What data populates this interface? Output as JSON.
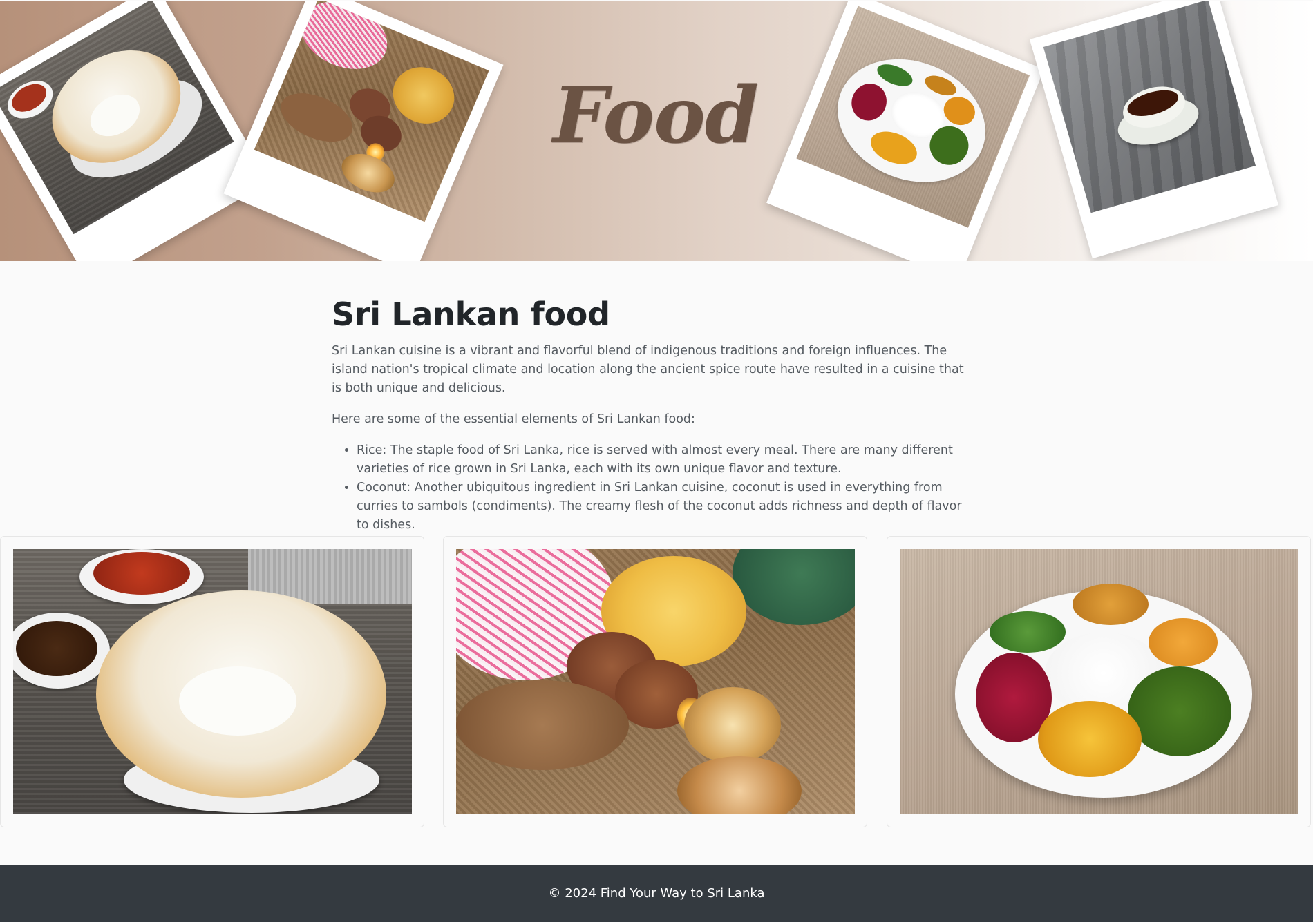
{
  "hero": {
    "title": "Food",
    "images": [
      {
        "icon": "hopper-dish-photo"
      },
      {
        "icon": "sri-lankan-sweets-photo"
      },
      {
        "icon": "rice-and-curry-photo"
      },
      {
        "icon": "tea-cup-photo"
      }
    ]
  },
  "article": {
    "heading": "Sri Lankan food",
    "intro": "Sri Lankan cuisine is a vibrant and flavorful blend of indigenous traditions and foreign influences. The island nation's tropical climate and location along the ancient spice route have resulted in a cuisine that is both unique and delicious.",
    "lead": "Here are some of the essential elements of Sri Lankan food:",
    "items": [
      "Rice: The staple food of Sri Lanka, rice is served with almost every meal. There are many different varieties of rice grown in Sri Lanka, each with its own unique flavor and texture.",
      "Coconut: Another ubiquitous ingredient in Sri Lankan cuisine, coconut is used in everything from curries to sambols (condiments). The creamy flesh of the coconut adds richness and depth of flavor to dishes."
    ]
  },
  "gallery": [
    {
      "icon": "hopper-dish-photo"
    },
    {
      "icon": "sri-lankan-sweets-photo"
    },
    {
      "icon": "rice-and-curry-photo"
    }
  ],
  "footer": {
    "copyright": "© 2024 Find Your Way to Sri Lanka"
  },
  "colors": {
    "footer_bg": "#343a40",
    "title_brown": "#6b5344",
    "hero_gradient_start": "#b6917a",
    "hero_gradient_end": "#ffffff"
  }
}
